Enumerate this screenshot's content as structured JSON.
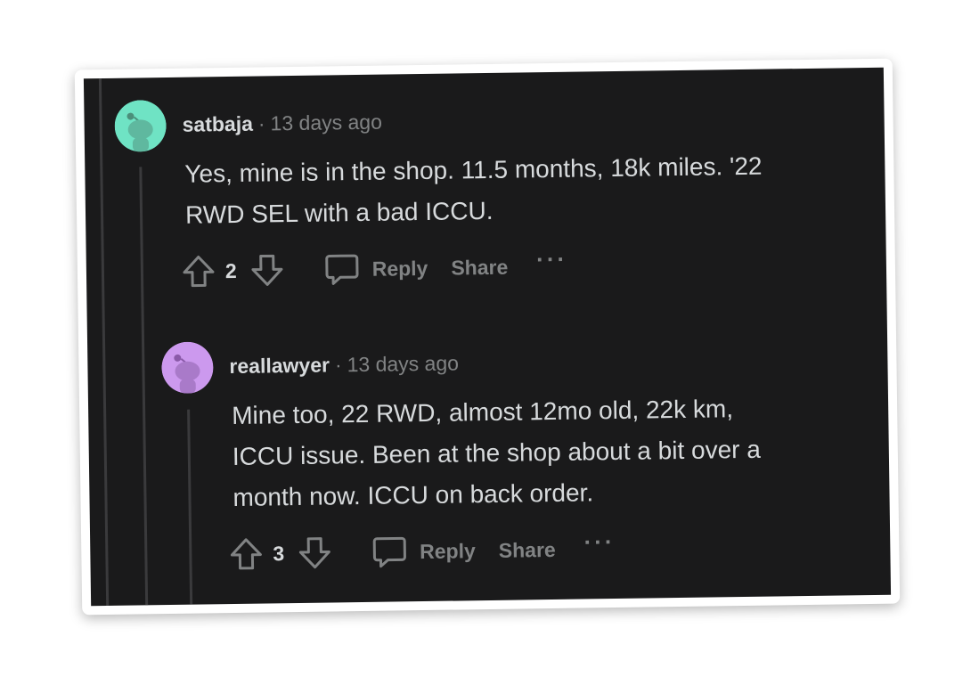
{
  "comments": [
    {
      "username": "satbaja",
      "separator": "·",
      "timestamp": "13 days ago",
      "avatar_color": "#6fe3c4",
      "body_lines": [
        "Yes, mine is in the shop. 11.5 months, 18k miles. '22",
        "RWD SEL with a bad ICCU."
      ],
      "score": "2",
      "reply_label": "Reply",
      "share_label": "Share",
      "more_label": "···"
    },
    {
      "username": "reallawyer",
      "separator": "·",
      "timestamp": "13 days ago",
      "avatar_color": "#cc99ee",
      "body_lines": [
        "Mine too, 22 RWD, almost 12mo old, 22k km,",
        "ICCU issue. Been at the shop about a bit over a",
        "month now. ICCU on back order."
      ],
      "score": "3",
      "reply_label": "Reply",
      "share_label": "Share",
      "more_label": "···"
    }
  ],
  "colors": {
    "background": "#1a1a1b",
    "text": "#d7dadc",
    "muted": "#818384",
    "thread_line": "#3a3a3c"
  }
}
